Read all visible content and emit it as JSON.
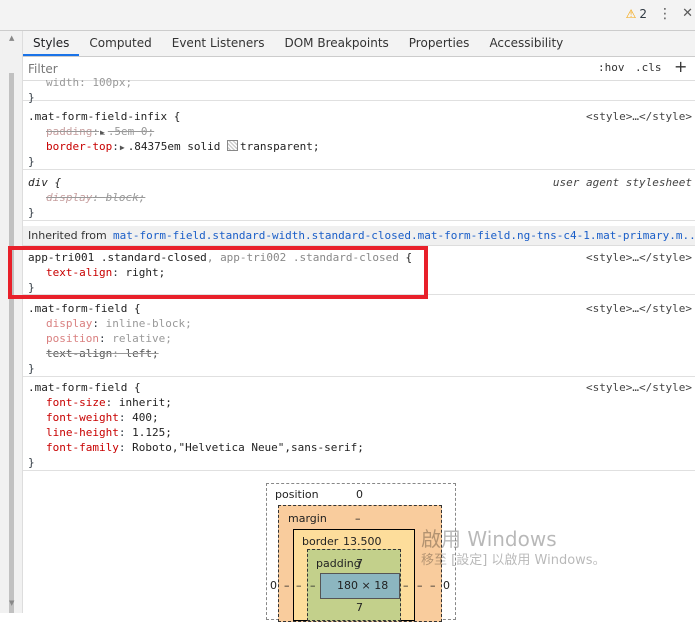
{
  "toolbar": {
    "warning_count": "2",
    "menu_icon": "kebab-menu-icon",
    "close_icon": "close-icon"
  },
  "tabs": [
    {
      "label": "Styles",
      "active": true
    },
    {
      "label": "Computed"
    },
    {
      "label": "Event Listeners"
    },
    {
      "label": "DOM Breakpoints"
    },
    {
      "label": "Properties"
    },
    {
      "label": "Accessibility"
    }
  ],
  "filter": {
    "placeholder": "Filter",
    "hov_label": ":hov",
    "cls_label": ".cls",
    "add_label": "+"
  },
  "rules": {
    "r0": {
      "partial_decl": "width: 100px;",
      "close": "}"
    },
    "r1": {
      "selector": ".mat-form-field-infix {",
      "source": "<style>…</style>",
      "d1_name": "padding",
      "d1_value": ".5em 0;",
      "d2_name": "border-top",
      "d2_value": ".84375em solid",
      "d2_color": "transparent;",
      "close": "}"
    },
    "r2": {
      "selector": "div {",
      "source": "user agent stylesheet",
      "d1_name": "display",
      "d1_value": "block;",
      "close": "}"
    },
    "inherited": {
      "label": "Inherited from",
      "selector": "mat-form-field.standard-width.standard-closed.mat-form-field.ng-tns-c4-1.mat-primary.m..."
    },
    "r3": {
      "selector_a": "app-tri001 .standard-closed",
      "selector_sep": ", ",
      "selector_b": "app-tri002 .standard-closed",
      "selector_end": " {",
      "source": "<style>…</style>",
      "d1_name": "text-align",
      "d1_value": "right;",
      "close": "}"
    },
    "r4": {
      "selector": ".mat-form-field {",
      "source": "<style>…</style>",
      "d1_name": "display",
      "d1_value": "inline-block;",
      "d2_name": "position",
      "d2_value": "relative;",
      "d3_name": "text-align",
      "d3_value": "left;",
      "close": "}"
    },
    "r5": {
      "selector": ".mat-form-field {",
      "source": "<style>…</style>",
      "d1_name": "font-size",
      "d1_value": "inherit;",
      "d2_name": "font-weight",
      "d2_value": "400;",
      "d3_name": "line-height",
      "d3_value": "1.125;",
      "d4_name": "font-family",
      "d4_value": "Roboto,\"Helvetica Neue\",sans-serif;",
      "close": "}"
    }
  },
  "box_model": {
    "position_label": "position",
    "position_value": "0",
    "margin_label": "margin",
    "margin_value": "–",
    "border_label": "border",
    "border_value": "13.500",
    "padding_label": "padding",
    "padding_top": "7",
    "content": "180 × 18",
    "padding_bottom": "7",
    "left_outer": "0",
    "right_outer": "0",
    "dash": "–"
  },
  "watermark": {
    "line1": "啟用 Windows",
    "line2": "移至 [設定] 以啟用 Windows。"
  },
  "colors": {
    "highlight": "#e8202a",
    "property": "#c80000",
    "accent": "#1a73e8"
  }
}
